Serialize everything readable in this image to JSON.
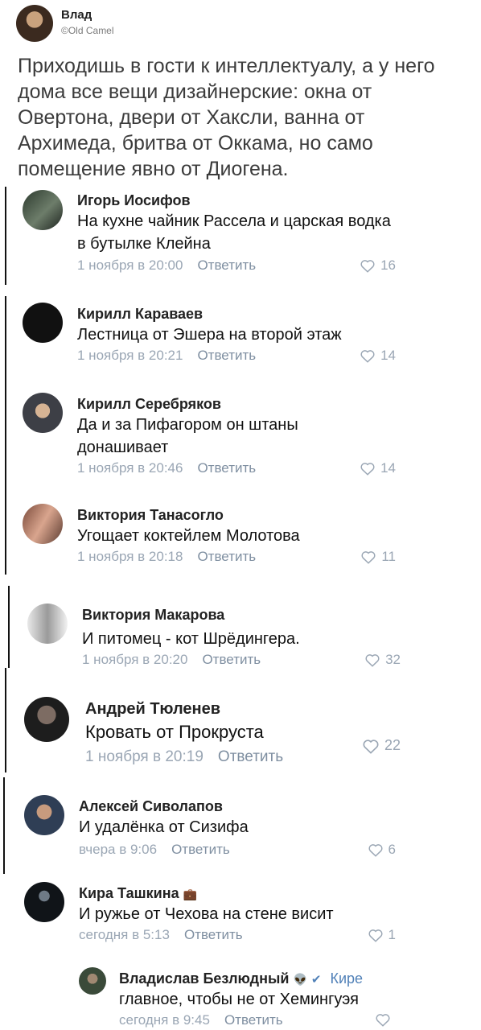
{
  "tweet": {
    "author": "Влад",
    "handle": "©Old Camel",
    "text": "Приходишь в гости к интеллектуалу, а у него дома все вещи дизайнерские: окна от Овертона, двери от Хаксли, ванна от Архимеда, бритва от Оккама, но само помещение явно от Диогена."
  },
  "reply_label": "Ответить",
  "comments": [
    {
      "author": "Игорь Иосифов",
      "text": "На кухне чайник Рассела и царская водка в бутылке Клейна",
      "time": "1 ноября в 20:00",
      "likes": "16"
    },
    {
      "author": "Кирилл Караваев",
      "text": "Лестница от Эшера на второй этаж",
      "time": "1 ноября в 20:21",
      "likes": "14"
    },
    {
      "author": "Кирилл Серебряков",
      "text": "Да и за Пифагором он штаны донашивает",
      "time": "1 ноября в 20:46",
      "likes": "14"
    },
    {
      "author": "Виктория Танасогло",
      "text": "Угощает коктейлем Молотова",
      "time": "1 ноября в 20:18",
      "likes": "11"
    },
    {
      "author": "Виктория Макарова",
      "text": "И питомец - кот Шрёдингера.",
      "time": "1 ноября в 20:20",
      "likes": "32"
    },
    {
      "author": "Андрей Тюленев",
      "text": "Кровать от Прокруста",
      "time": "1 ноября в 20:19",
      "likes": "22"
    },
    {
      "author": "Алексей Сиволапов",
      "text": "И удалёнка от Сизифа",
      "time": "вчера в 9:06",
      "likes": "6"
    },
    {
      "author": "Кира Ташкина",
      "badge": "💼",
      "text": "И ружье от Чехова на стене висит",
      "time": "сегодня в 5:13",
      "likes": "1"
    },
    {
      "author": "Владислав Безлюдный",
      "badge": "👽",
      "addressee": "Кире",
      "text": "главное, чтобы не от Хемингуэя",
      "time": "сегодня в 9:45",
      "likes": ""
    }
  ],
  "colors": {
    "meta": "#9aa6b4",
    "verified": "#5181b8",
    "addressee": "#5181b8"
  }
}
